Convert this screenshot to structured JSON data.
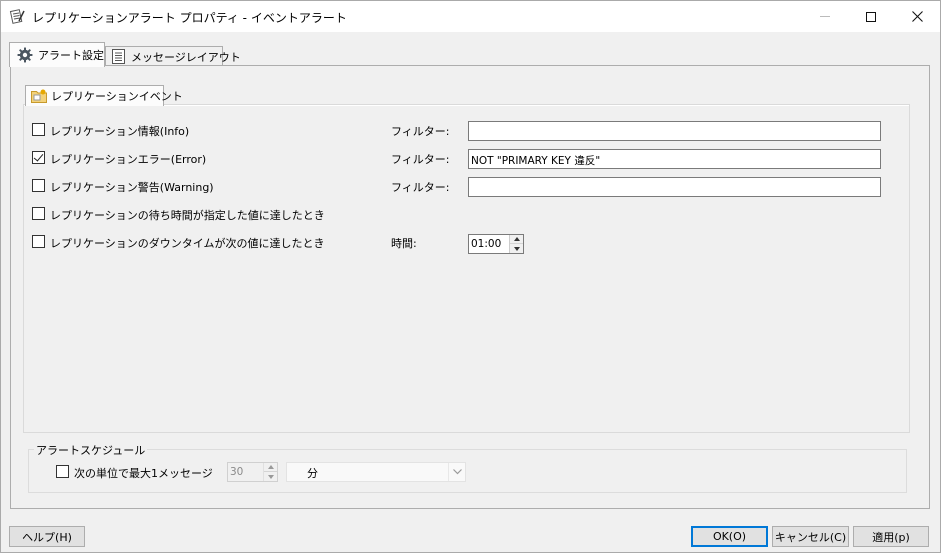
{
  "window": {
    "title": "レプリケーションアラート プロパティ - イベントアラート",
    "icon": "notepad-pen-icon"
  },
  "tabs": [
    {
      "label": "アラート設定",
      "icon": "gear-icon",
      "active": true
    },
    {
      "label": "メッセージレイアウト",
      "icon": "document-lines-icon",
      "active": false
    }
  ],
  "sub_tab": {
    "label": "レプリケーションイベント",
    "icon": "folder-event-icon"
  },
  "events": [
    {
      "label": "レプリケーション情報(Info)",
      "checked": false,
      "field_label": "フィルター:",
      "field_value": ""
    },
    {
      "label": "レプリケーションエラー(Error)",
      "checked": true,
      "field_label": "フィルター:",
      "field_value": "NOT \"PRIMARY KEY 違反\""
    },
    {
      "label": "レプリケーション警告(Warning)",
      "checked": false,
      "field_label": "フィルター:",
      "field_value": ""
    },
    {
      "label": "レプリケーションの待ち時間が指定した値に達したとき",
      "checked": false
    },
    {
      "label": "レプリケーションのダウンタイムが次の値に達したとき",
      "checked": false,
      "field_label": "時間:",
      "field_value": "01:00"
    }
  ],
  "schedule": {
    "legend": "アラートスケジュール",
    "checkbox_label": "次の単位で最大1メッセージ",
    "checked": false,
    "count_value": "30",
    "unit_value": "分"
  },
  "buttons": {
    "help": "ヘルプ(H)",
    "ok": "OK(O)",
    "cancel": "キャンセル(C)",
    "apply": "適用(p)"
  }
}
